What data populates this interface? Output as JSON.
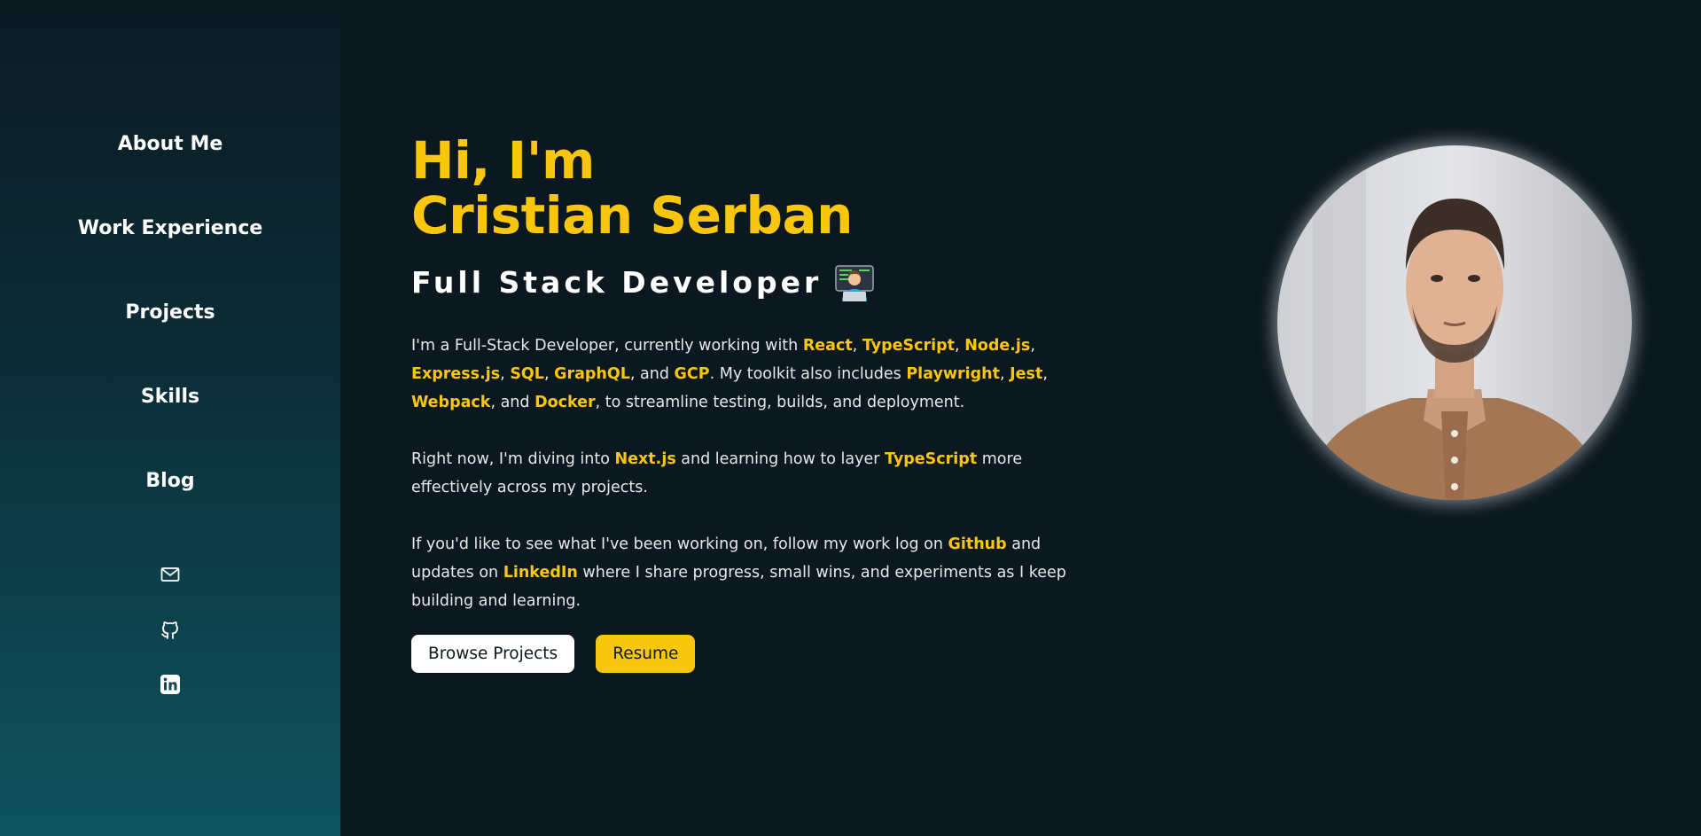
{
  "nav": {
    "items": [
      "About Me",
      "Work Experience",
      "Projects",
      "Skills",
      "Blog"
    ]
  },
  "social": {
    "icons": [
      "mail-icon",
      "github-icon",
      "linkedin-icon"
    ]
  },
  "hero": {
    "greeting": "Hi, I'm",
    "name": "Cristian Serban",
    "role": "Full Stack Developer"
  },
  "intro": {
    "p1": {
      "t1": "I'm a Full-Stack Developer, currently working with ",
      "react": "React",
      "c1": ", ",
      "typescript": "TypeScript",
      "c2": ", ",
      "node": "Node.js",
      "c3": ", ",
      "express": "Express.js",
      "c4": ", ",
      "sql": "SQL",
      "c5": ", ",
      "graphql": "GraphQL",
      "c6": ", and ",
      "gcp": "GCP",
      "t2": ". My toolkit also includes ",
      "playwright": "Playwright",
      "c7": ", ",
      "jest": "Jest",
      "c8": ", ",
      "webpack": "Webpack",
      "c9": ", and ",
      "docker": "Docker",
      "t3": ", to streamline testing, builds, and deployment."
    },
    "p2": {
      "t1": "Right now, I'm diving into ",
      "next": "Next.js",
      "t2": " and learning how to layer ",
      "typescript": "TypeScript",
      "t3": " more effectively across my projects."
    },
    "p3": {
      "t1": "If you'd like to see what I've been working on, follow my work log on ",
      "github": "Github",
      "t2": " and updates on ",
      "linkedin": "LinkedIn",
      "t3": " where I share progress, small wins, and experiments as I keep building and learning."
    }
  },
  "buttons": {
    "browse": "Browse Projects",
    "resume": "Resume"
  },
  "colors": {
    "accent": "#f9c60e",
    "background": "#0c1820",
    "sidebar_gradient_end": "#0e5460"
  }
}
